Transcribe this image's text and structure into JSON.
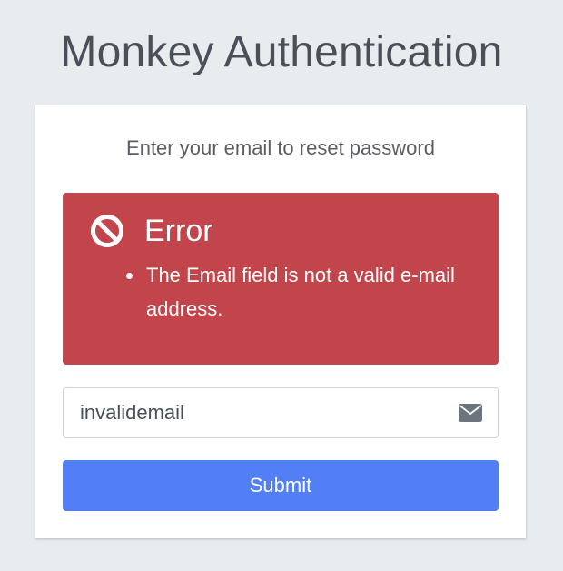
{
  "header": {
    "title": "Monkey Authentication"
  },
  "card": {
    "message": "Enter your email to reset password"
  },
  "alert": {
    "icon": "ban-icon",
    "title": "Error",
    "errors": [
      "The Email field is not a valid e-mail address."
    ],
    "background_color": "#c1454b"
  },
  "email_field": {
    "value": "invalidemail",
    "icon": "envelope-icon"
  },
  "submit": {
    "label": "Submit",
    "color": "#527ff5"
  }
}
